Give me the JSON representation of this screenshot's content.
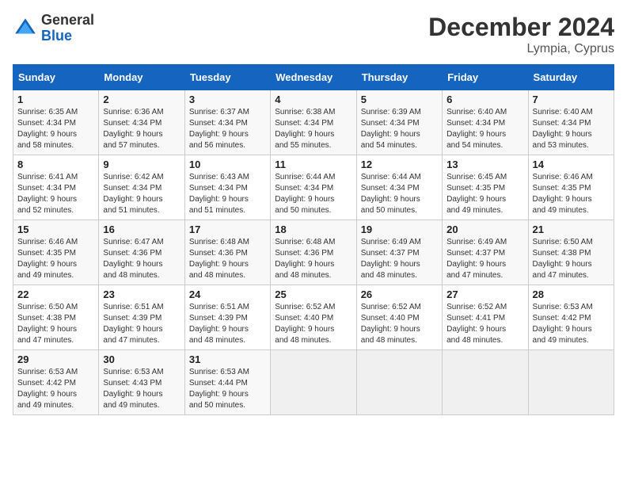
{
  "logo": {
    "general": "General",
    "blue": "Blue"
  },
  "title": "December 2024",
  "location": "Lympia, Cyprus",
  "days_header": [
    "Sunday",
    "Monday",
    "Tuesday",
    "Wednesday",
    "Thursday",
    "Friday",
    "Saturday"
  ],
  "weeks": [
    [
      {
        "day": "1",
        "sunrise": "6:35 AM",
        "sunset": "4:34 PM",
        "daylight": "9 hours and 58 minutes."
      },
      {
        "day": "2",
        "sunrise": "6:36 AM",
        "sunset": "4:34 PM",
        "daylight": "9 hours and 57 minutes."
      },
      {
        "day": "3",
        "sunrise": "6:37 AM",
        "sunset": "4:34 PM",
        "daylight": "9 hours and 56 minutes."
      },
      {
        "day": "4",
        "sunrise": "6:38 AM",
        "sunset": "4:34 PM",
        "daylight": "9 hours and 55 minutes."
      },
      {
        "day": "5",
        "sunrise": "6:39 AM",
        "sunset": "4:34 PM",
        "daylight": "9 hours and 54 minutes."
      },
      {
        "day": "6",
        "sunrise": "6:40 AM",
        "sunset": "4:34 PM",
        "daylight": "9 hours and 54 minutes."
      },
      {
        "day": "7",
        "sunrise": "6:40 AM",
        "sunset": "4:34 PM",
        "daylight": "9 hours and 53 minutes."
      }
    ],
    [
      {
        "day": "8",
        "sunrise": "6:41 AM",
        "sunset": "4:34 PM",
        "daylight": "9 hours and 52 minutes."
      },
      {
        "day": "9",
        "sunrise": "6:42 AM",
        "sunset": "4:34 PM",
        "daylight": "9 hours and 51 minutes."
      },
      {
        "day": "10",
        "sunrise": "6:43 AM",
        "sunset": "4:34 PM",
        "daylight": "9 hours and 51 minutes."
      },
      {
        "day": "11",
        "sunrise": "6:44 AM",
        "sunset": "4:34 PM",
        "daylight": "9 hours and 50 minutes."
      },
      {
        "day": "12",
        "sunrise": "6:44 AM",
        "sunset": "4:34 PM",
        "daylight": "9 hours and 50 minutes."
      },
      {
        "day": "13",
        "sunrise": "6:45 AM",
        "sunset": "4:35 PM",
        "daylight": "9 hours and 49 minutes."
      },
      {
        "day": "14",
        "sunrise": "6:46 AM",
        "sunset": "4:35 PM",
        "daylight": "9 hours and 49 minutes."
      }
    ],
    [
      {
        "day": "15",
        "sunrise": "6:46 AM",
        "sunset": "4:35 PM",
        "daylight": "9 hours and 49 minutes."
      },
      {
        "day": "16",
        "sunrise": "6:47 AM",
        "sunset": "4:36 PM",
        "daylight": "9 hours and 48 minutes."
      },
      {
        "day": "17",
        "sunrise": "6:48 AM",
        "sunset": "4:36 PM",
        "daylight": "9 hours and 48 minutes."
      },
      {
        "day": "18",
        "sunrise": "6:48 AM",
        "sunset": "4:36 PM",
        "daylight": "9 hours and 48 minutes."
      },
      {
        "day": "19",
        "sunrise": "6:49 AM",
        "sunset": "4:37 PM",
        "daylight": "9 hours and 48 minutes."
      },
      {
        "day": "20",
        "sunrise": "6:49 AM",
        "sunset": "4:37 PM",
        "daylight": "9 hours and 47 minutes."
      },
      {
        "day": "21",
        "sunrise": "6:50 AM",
        "sunset": "4:38 PM",
        "daylight": "9 hours and 47 minutes."
      }
    ],
    [
      {
        "day": "22",
        "sunrise": "6:50 AM",
        "sunset": "4:38 PM",
        "daylight": "9 hours and 47 minutes."
      },
      {
        "day": "23",
        "sunrise": "6:51 AM",
        "sunset": "4:39 PM",
        "daylight": "9 hours and 47 minutes."
      },
      {
        "day": "24",
        "sunrise": "6:51 AM",
        "sunset": "4:39 PM",
        "daylight": "9 hours and 48 minutes."
      },
      {
        "day": "25",
        "sunrise": "6:52 AM",
        "sunset": "4:40 PM",
        "daylight": "9 hours and 48 minutes."
      },
      {
        "day": "26",
        "sunrise": "6:52 AM",
        "sunset": "4:40 PM",
        "daylight": "9 hours and 48 minutes."
      },
      {
        "day": "27",
        "sunrise": "6:52 AM",
        "sunset": "4:41 PM",
        "daylight": "9 hours and 48 minutes."
      },
      {
        "day": "28",
        "sunrise": "6:53 AM",
        "sunset": "4:42 PM",
        "daylight": "9 hours and 49 minutes."
      }
    ],
    [
      {
        "day": "29",
        "sunrise": "6:53 AM",
        "sunset": "4:42 PM",
        "daylight": "9 hours and 49 minutes."
      },
      {
        "day": "30",
        "sunrise": "6:53 AM",
        "sunset": "4:43 PM",
        "daylight": "9 hours and 49 minutes."
      },
      {
        "day": "31",
        "sunrise": "6:53 AM",
        "sunset": "4:44 PM",
        "daylight": "9 hours and 50 minutes."
      },
      null,
      null,
      null,
      null
    ]
  ]
}
